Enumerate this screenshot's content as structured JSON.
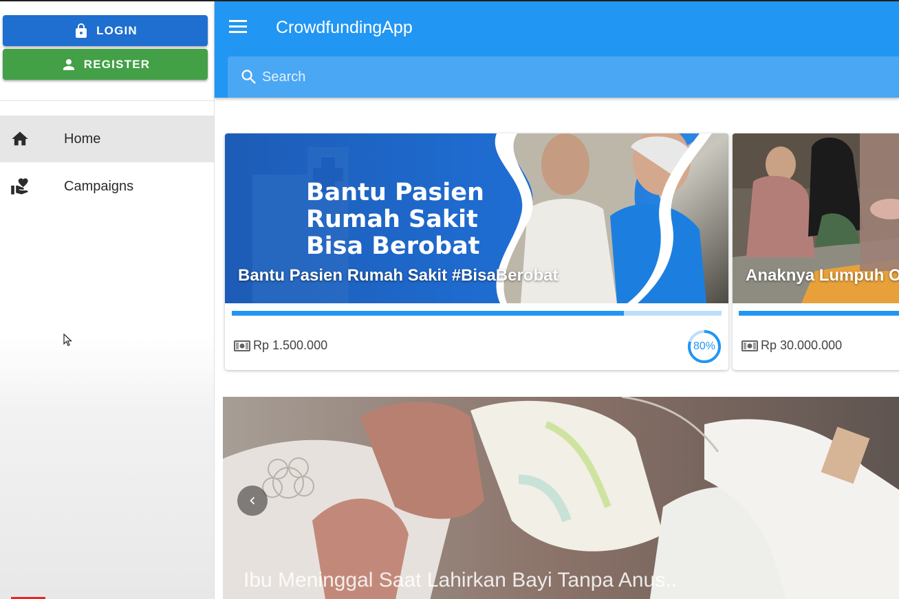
{
  "sidebar": {
    "login_label": "LOGIN",
    "register_label": "REGISTER",
    "items": [
      {
        "label": "Home",
        "icon": "home-icon",
        "active": true
      },
      {
        "label": "Campaigns",
        "icon": "volunteer-icon",
        "active": false
      }
    ]
  },
  "appbar": {
    "title": "CrowdfundingApp",
    "search_placeholder": "Search"
  },
  "campaigns": [
    {
      "title": "Bantu Pasien Rumah Sakit #BisaBerobat",
      "image_text": [
        "Bantu Pasien",
        "Rumah Sakit",
        "Bisa Berobat"
      ],
      "amount": "Rp 1.500.000",
      "progress": 0.8,
      "percent_label": "80%"
    },
    {
      "title": "Anaknya Lumpuh Ot",
      "amount": "Rp 30.000.000",
      "progress": 1.0
    }
  ],
  "hero": {
    "title": "Ibu Meninggal Saat Lahirkan Bayi Tanpa Anus.."
  },
  "colors": {
    "primary": "#2196f3",
    "login_button": "#1e6fd0",
    "register_button": "#43a047",
    "search_bg": "#4aa7f4"
  }
}
